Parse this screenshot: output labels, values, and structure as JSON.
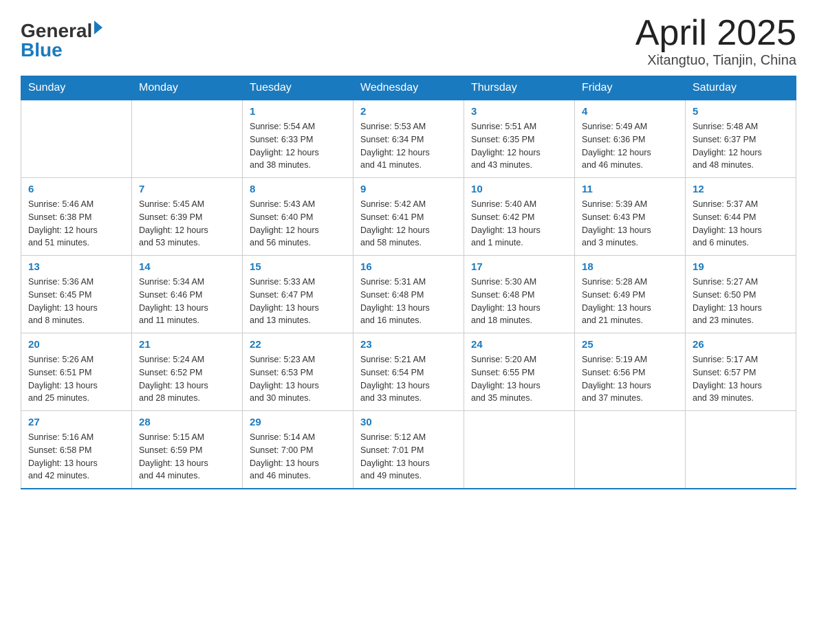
{
  "header": {
    "logo_general": "General",
    "logo_blue": "Blue",
    "title": "April 2025",
    "subtitle": "Xitangtuo, Tianjin, China"
  },
  "days_of_week": [
    "Sunday",
    "Monday",
    "Tuesday",
    "Wednesday",
    "Thursday",
    "Friday",
    "Saturday"
  ],
  "weeks": [
    [
      {
        "day": "",
        "info": ""
      },
      {
        "day": "",
        "info": ""
      },
      {
        "day": "1",
        "info": "Sunrise: 5:54 AM\nSunset: 6:33 PM\nDaylight: 12 hours\nand 38 minutes."
      },
      {
        "day": "2",
        "info": "Sunrise: 5:53 AM\nSunset: 6:34 PM\nDaylight: 12 hours\nand 41 minutes."
      },
      {
        "day": "3",
        "info": "Sunrise: 5:51 AM\nSunset: 6:35 PM\nDaylight: 12 hours\nand 43 minutes."
      },
      {
        "day": "4",
        "info": "Sunrise: 5:49 AM\nSunset: 6:36 PM\nDaylight: 12 hours\nand 46 minutes."
      },
      {
        "day": "5",
        "info": "Sunrise: 5:48 AM\nSunset: 6:37 PM\nDaylight: 12 hours\nand 48 minutes."
      }
    ],
    [
      {
        "day": "6",
        "info": "Sunrise: 5:46 AM\nSunset: 6:38 PM\nDaylight: 12 hours\nand 51 minutes."
      },
      {
        "day": "7",
        "info": "Sunrise: 5:45 AM\nSunset: 6:39 PM\nDaylight: 12 hours\nand 53 minutes."
      },
      {
        "day": "8",
        "info": "Sunrise: 5:43 AM\nSunset: 6:40 PM\nDaylight: 12 hours\nand 56 minutes."
      },
      {
        "day": "9",
        "info": "Sunrise: 5:42 AM\nSunset: 6:41 PM\nDaylight: 12 hours\nand 58 minutes."
      },
      {
        "day": "10",
        "info": "Sunrise: 5:40 AM\nSunset: 6:42 PM\nDaylight: 13 hours\nand 1 minute."
      },
      {
        "day": "11",
        "info": "Sunrise: 5:39 AM\nSunset: 6:43 PM\nDaylight: 13 hours\nand 3 minutes."
      },
      {
        "day": "12",
        "info": "Sunrise: 5:37 AM\nSunset: 6:44 PM\nDaylight: 13 hours\nand 6 minutes."
      }
    ],
    [
      {
        "day": "13",
        "info": "Sunrise: 5:36 AM\nSunset: 6:45 PM\nDaylight: 13 hours\nand 8 minutes."
      },
      {
        "day": "14",
        "info": "Sunrise: 5:34 AM\nSunset: 6:46 PM\nDaylight: 13 hours\nand 11 minutes."
      },
      {
        "day": "15",
        "info": "Sunrise: 5:33 AM\nSunset: 6:47 PM\nDaylight: 13 hours\nand 13 minutes."
      },
      {
        "day": "16",
        "info": "Sunrise: 5:31 AM\nSunset: 6:48 PM\nDaylight: 13 hours\nand 16 minutes."
      },
      {
        "day": "17",
        "info": "Sunrise: 5:30 AM\nSunset: 6:48 PM\nDaylight: 13 hours\nand 18 minutes."
      },
      {
        "day": "18",
        "info": "Sunrise: 5:28 AM\nSunset: 6:49 PM\nDaylight: 13 hours\nand 21 minutes."
      },
      {
        "day": "19",
        "info": "Sunrise: 5:27 AM\nSunset: 6:50 PM\nDaylight: 13 hours\nand 23 minutes."
      }
    ],
    [
      {
        "day": "20",
        "info": "Sunrise: 5:26 AM\nSunset: 6:51 PM\nDaylight: 13 hours\nand 25 minutes."
      },
      {
        "day": "21",
        "info": "Sunrise: 5:24 AM\nSunset: 6:52 PM\nDaylight: 13 hours\nand 28 minutes."
      },
      {
        "day": "22",
        "info": "Sunrise: 5:23 AM\nSunset: 6:53 PM\nDaylight: 13 hours\nand 30 minutes."
      },
      {
        "day": "23",
        "info": "Sunrise: 5:21 AM\nSunset: 6:54 PM\nDaylight: 13 hours\nand 33 minutes."
      },
      {
        "day": "24",
        "info": "Sunrise: 5:20 AM\nSunset: 6:55 PM\nDaylight: 13 hours\nand 35 minutes."
      },
      {
        "day": "25",
        "info": "Sunrise: 5:19 AM\nSunset: 6:56 PM\nDaylight: 13 hours\nand 37 minutes."
      },
      {
        "day": "26",
        "info": "Sunrise: 5:17 AM\nSunset: 6:57 PM\nDaylight: 13 hours\nand 39 minutes."
      }
    ],
    [
      {
        "day": "27",
        "info": "Sunrise: 5:16 AM\nSunset: 6:58 PM\nDaylight: 13 hours\nand 42 minutes."
      },
      {
        "day": "28",
        "info": "Sunrise: 5:15 AM\nSunset: 6:59 PM\nDaylight: 13 hours\nand 44 minutes."
      },
      {
        "day": "29",
        "info": "Sunrise: 5:14 AM\nSunset: 7:00 PM\nDaylight: 13 hours\nand 46 minutes."
      },
      {
        "day": "30",
        "info": "Sunrise: 5:12 AM\nSunset: 7:01 PM\nDaylight: 13 hours\nand 49 minutes."
      },
      {
        "day": "",
        "info": ""
      },
      {
        "day": "",
        "info": ""
      },
      {
        "day": "",
        "info": ""
      }
    ]
  ]
}
